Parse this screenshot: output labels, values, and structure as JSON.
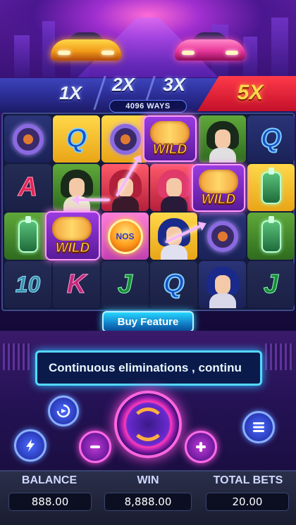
{
  "multipliers": {
    "m1": "1X",
    "m2": "2X",
    "m3": "3X",
    "m5": "5X"
  },
  "ways_label": "4096 WAYS",
  "symbols": {
    "q": "Q",
    "a": "A",
    "ten": "10",
    "k": "K",
    "j": "J"
  },
  "wild_label": "WILD",
  "nos_label": "NOS",
  "buy_feature_label": "Buy Feature",
  "marquee_text": "Continuous eliminations , continu",
  "footer": {
    "balance_label": "BALANCE",
    "balance_value": "888.00",
    "win_label": "WIN",
    "win_value": "8,888.00",
    "total_bets_label": "TOTAL BETS",
    "total_bets_value": "20.00"
  },
  "colors": {
    "accent_pink": "#ff4fe0",
    "accent_cyan": "#3ad8ff",
    "active_multiplier": "#ff3a4a",
    "wild_gold": "#ffd84a"
  },
  "icons": [
    "lightning-icon",
    "autoplay-icon",
    "minus-icon",
    "spin-icon",
    "plus-icon",
    "menu-icon"
  ]
}
